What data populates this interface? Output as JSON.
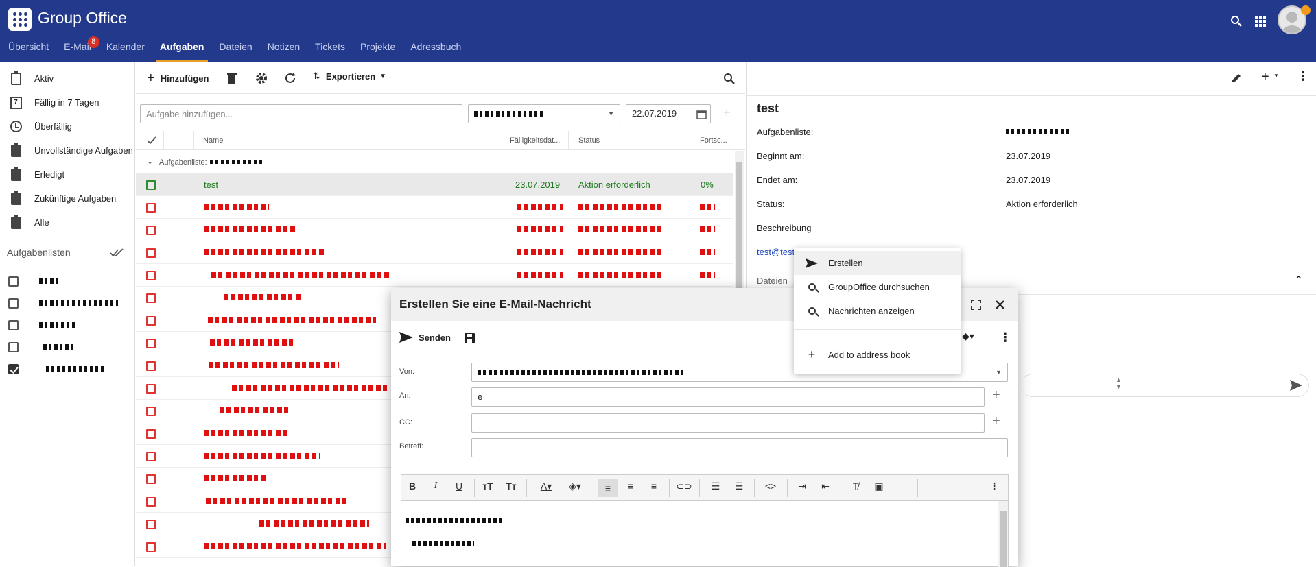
{
  "app": {
    "title": "Group Office",
    "tabs": [
      {
        "label": "Übersicht"
      },
      {
        "label": "E-Mail",
        "badge": "8"
      },
      {
        "label": "Kalender"
      },
      {
        "label": "Aufgaben",
        "active": true
      },
      {
        "label": "Dateien"
      },
      {
        "label": "Notizen"
      },
      {
        "label": "Tickets"
      },
      {
        "label": "Projekte"
      },
      {
        "label": "Adressbuch"
      }
    ]
  },
  "sidebar": {
    "filters": [
      {
        "label": "Aktiv",
        "icon": "clipboard-icon"
      },
      {
        "label": "Fällig in 7 Tagen",
        "icon": "calendar-7-icon"
      },
      {
        "label": "Überfällig",
        "icon": "clock-icon"
      },
      {
        "label": "Unvollständige Aufgaben",
        "icon": "clipboard-alert-icon"
      },
      {
        "label": "Erledigt",
        "icon": "clipboard-check-icon"
      },
      {
        "label": "Zukünftige Aufgaben",
        "icon": "clipboard-arrow-icon"
      },
      {
        "label": "Alle",
        "icon": "clipboard-list-icon"
      }
    ],
    "lists_header": "Aufgabenlisten"
  },
  "middle": {
    "add_label": "Hinzufügen",
    "export_label": "Exportieren",
    "add_task_placeholder": "Aufgabe hinzufügen...",
    "date_value": "22.07.2019",
    "columns": {
      "name": "Name",
      "due": "Fälligkeitsdat...",
      "status": "Status",
      "progress": "Fortsc..."
    },
    "group_label": "Aufgabenliste:",
    "selected_task": {
      "name": "test",
      "due": "23.07.2019",
      "status": "Aktion erforderlich",
      "progress": "0%"
    }
  },
  "detail": {
    "title": "test",
    "fields": [
      {
        "label": "Aufgabenliste:",
        "value": ""
      },
      {
        "label": "Beginnt am:",
        "value": "23.07.2019"
      },
      {
        "label": "Endet am:",
        "value": "23.07.2019"
      },
      {
        "label": "Status:",
        "value": "Aktion erforderlich"
      },
      {
        "label": "Beschreibung",
        "value": ""
      }
    ],
    "email_link": "test@test",
    "files_label": "Dateien"
  },
  "dialog": {
    "title": "Erstellen Sie eine E-Mail-Nachricht",
    "send_label": "Senden",
    "from_label": "Von:",
    "to_label": "An:",
    "to_value": "e",
    "cc_label": "CC:",
    "subject_label": "Betreff:"
  },
  "context_menu": {
    "items": [
      {
        "label": "Erstellen",
        "icon": "send-icon"
      },
      {
        "label": "GroupOffice durchsuchen",
        "icon": "search-icon"
      },
      {
        "label": "Nachrichten anzeigen",
        "icon": "search-icon"
      },
      {
        "label": "Add to address book",
        "icon": "plus-icon"
      }
    ]
  },
  "colors": {
    "header": "#233a8c",
    "accent": "#e9a02b",
    "overdue": "#e01010",
    "ok": "#1d7a1d"
  }
}
